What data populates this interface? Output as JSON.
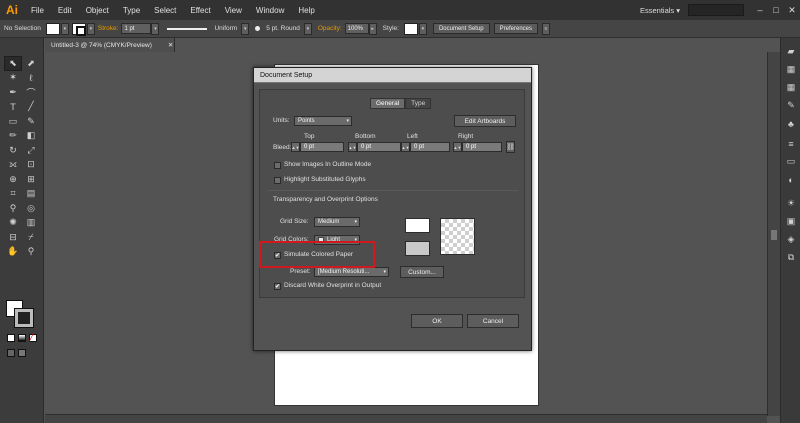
{
  "app": {
    "logo": "Ai",
    "menu": [
      "File",
      "Edit",
      "Object",
      "Type",
      "Select",
      "Effect",
      "View",
      "Window",
      "Help"
    ],
    "workspace": "Essentials ▾",
    "window_controls": [
      "–",
      "□",
      "✕"
    ]
  },
  "control_bar": {
    "selection": "No Selection",
    "stroke_label": "Stroke:",
    "stroke_weight": "1 pt",
    "profile": "Uniform",
    "brush": "5 pt. Round",
    "opacity_label": "Opacity:",
    "opacity": "100%",
    "style_label": "Style:",
    "doc_setup": "Document Setup",
    "preferences": "Preferences"
  },
  "document": {
    "tab_title": "Untitled-3 @ 74% (CMYK/Preview)",
    "tab_close": "✕"
  },
  "dialog": {
    "title": "Document Setup",
    "tabs": [
      "General",
      "Type"
    ],
    "units_label": "Units:",
    "units_value": "Points",
    "edit_artboards": "Edit Artboards",
    "bleed_label": "Bleed:",
    "bleed": [
      {
        "label": "Top",
        "value": "0 pt"
      },
      {
        "label": "Bottom",
        "value": "0 pt"
      },
      {
        "label": "Left",
        "value": "0 pt"
      },
      {
        "label": "Right",
        "value": "0 pt"
      }
    ],
    "show_images_outline": {
      "label": "Show Images In Outline Mode",
      "checked": false
    },
    "highlight_glyphs": {
      "label": "Highlight Substituted Glyphs",
      "checked": false
    },
    "transparency_section": "Transparency and Overprint Options",
    "grid_size_label": "Grid Size:",
    "grid_size_value": "Medium",
    "grid_colors_label": "Grid Colors:",
    "grid_colors_value": "Light",
    "simulate_paper": {
      "label": "Simulate Colored Paper",
      "checked": true
    },
    "preset_label": "Preset:",
    "preset_value": "[Medium Resoluti...",
    "custom_button": "Custom...",
    "discard_white": {
      "label": "Discard White Overprint in Output",
      "checked": true
    },
    "ok": "OK",
    "cancel": "Cancel",
    "check_mark": "✔",
    "highlight_color": "#d0191d"
  }
}
